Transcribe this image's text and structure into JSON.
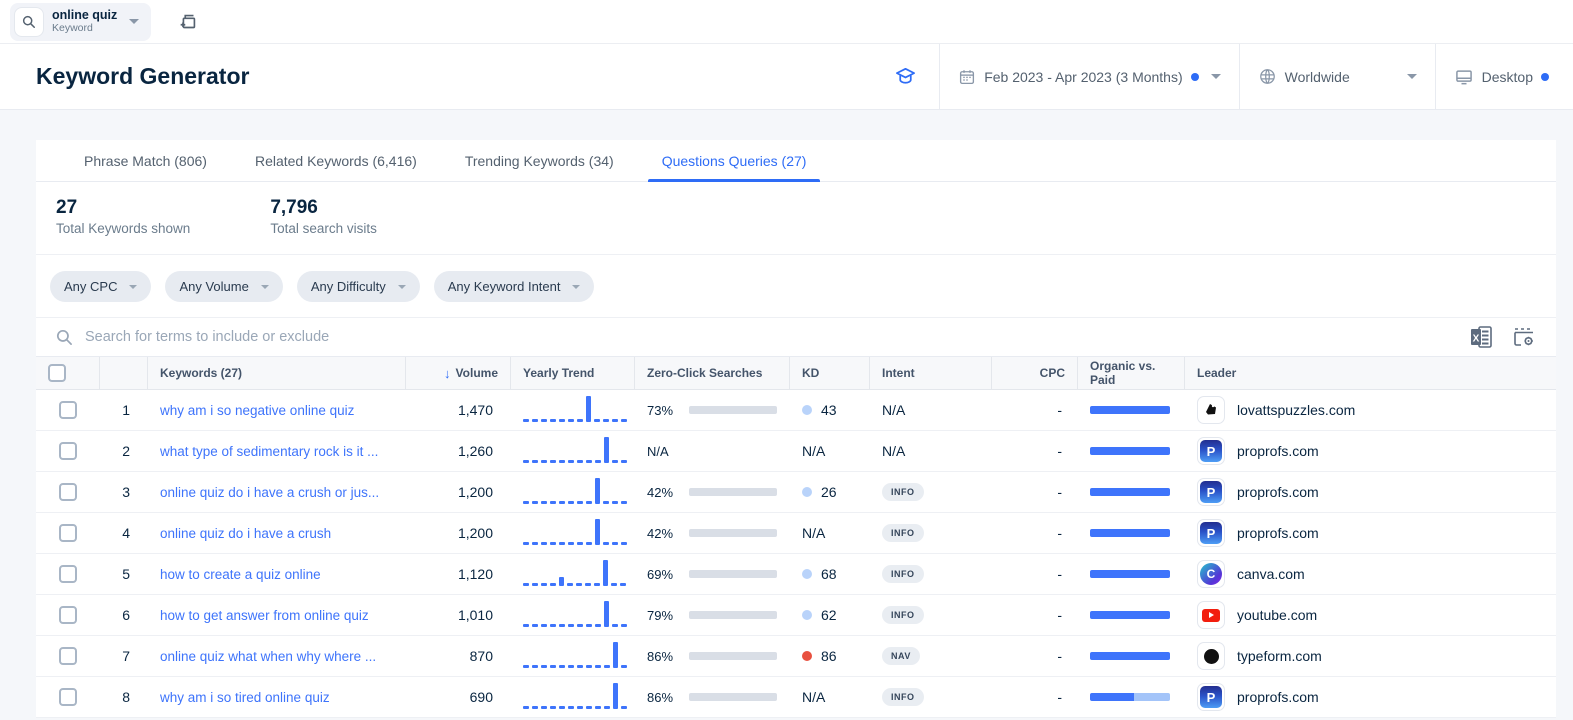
{
  "topbar": {
    "keyword_value": "online quiz",
    "keyword_type_label": "Keyword"
  },
  "header": {
    "title": "Keyword Generator",
    "date_range": "Feb 2023 - Apr 2023 (3 Months)",
    "region": "Worldwide",
    "device": "Desktop"
  },
  "tabs": [
    {
      "label": "Phrase Match (806)",
      "active": false
    },
    {
      "label": "Related Keywords (6,416)",
      "active": false
    },
    {
      "label": "Trending Keywords (34)",
      "active": false
    },
    {
      "label": "Questions Queries (27)",
      "active": true
    }
  ],
  "stats": [
    {
      "value": "27",
      "label": "Total Keywords shown"
    },
    {
      "value": "7,796",
      "label": "Total search visits"
    }
  ],
  "filters": [
    "Any CPC",
    "Any Volume",
    "Any Difficulty",
    "Any Keyword Intent"
  ],
  "search": {
    "placeholder": "Search for terms to include or exclude"
  },
  "colors": {
    "accent": "#2e6cf6",
    "bar_blue": "#3e74fb",
    "kd_dot_low": "#b9d3fa",
    "kd_dot_high": "#e8503f",
    "paid_bar": "#a3c4f9"
  },
  "table": {
    "columns": [
      {
        "label": ""
      },
      {
        "label": ""
      },
      {
        "label": "Keywords (27)"
      },
      {
        "label": "Volume",
        "sorted": true
      },
      {
        "label": "Yearly Trend"
      },
      {
        "label": "Zero-Click Searches"
      },
      {
        "label": "KD"
      },
      {
        "label": "Intent"
      },
      {
        "label": "CPC"
      },
      {
        "label": "Organic vs. Paid"
      },
      {
        "label": "Leader"
      }
    ],
    "rows": [
      {
        "rank": "1",
        "keyword": "why am i so negative online quiz",
        "volume": "1,470",
        "trend": [
          0,
          0,
          0,
          0,
          0,
          0,
          0,
          1,
          0,
          0,
          0,
          0
        ],
        "zero_click": "73%",
        "zero_click_pct": 73,
        "kd": "43",
        "kd_dot": "low",
        "intent": "N/A",
        "intent_type": "text",
        "cpc": "-",
        "organic_pct": 100,
        "leader": "lovattspuzzles.com",
        "favicon": "puzzle"
      },
      {
        "rank": "2",
        "keyword": "what type of sedimentary rock is it ...",
        "volume": "1,260",
        "trend": [
          0,
          0,
          0,
          0,
          0,
          0,
          0,
          0,
          0,
          1,
          0,
          0
        ],
        "zero_click": "N/A",
        "zero_click_pct": null,
        "kd": "N/A",
        "kd_dot": null,
        "intent": "N/A",
        "intent_type": "text",
        "cpc": "-",
        "organic_pct": 100,
        "leader": "proprofs.com",
        "favicon": "proprofs"
      },
      {
        "rank": "3",
        "keyword": "online quiz do i have a crush or jus...",
        "volume": "1,200",
        "trend": [
          0,
          0,
          0,
          0,
          0,
          0,
          0,
          0,
          1,
          0,
          0,
          0
        ],
        "zero_click": "42%",
        "zero_click_pct": 42,
        "kd": "26",
        "kd_dot": "low",
        "intent": "INFO",
        "intent_type": "badge",
        "cpc": "-",
        "organic_pct": 100,
        "leader": "proprofs.com",
        "favicon": "proprofs"
      },
      {
        "rank": "4",
        "keyword": "online quiz do i have a crush",
        "volume": "1,200",
        "trend": [
          0,
          0,
          0,
          0,
          0,
          0,
          0,
          0,
          1,
          0,
          0,
          0
        ],
        "zero_click": "42%",
        "zero_click_pct": 42,
        "kd": "N/A",
        "kd_dot": null,
        "intent": "INFO",
        "intent_type": "badge",
        "cpc": "-",
        "organic_pct": 100,
        "leader": "proprofs.com",
        "favicon": "proprofs"
      },
      {
        "rank": "5",
        "keyword": "how to create a quiz online",
        "volume": "1,120",
        "trend": [
          0,
          0,
          0,
          0,
          0.35,
          0,
          0,
          0,
          0,
          1,
          0,
          0
        ],
        "zero_click": "69%",
        "zero_click_pct": 69,
        "kd": "68",
        "kd_dot": "low",
        "intent": "INFO",
        "intent_type": "badge",
        "cpc": "-",
        "organic_pct": 100,
        "leader": "canva.com",
        "favicon": "canva"
      },
      {
        "rank": "6",
        "keyword": "how to get answer from online quiz",
        "volume": "1,010",
        "trend": [
          0,
          0,
          0,
          0,
          0,
          0,
          0,
          0,
          0,
          1,
          0,
          0
        ],
        "zero_click": "79%",
        "zero_click_pct": 79,
        "kd": "62",
        "kd_dot": "low",
        "intent": "INFO",
        "intent_type": "badge",
        "cpc": "-",
        "organic_pct": 100,
        "leader": "youtube.com",
        "favicon": "youtube"
      },
      {
        "rank": "7",
        "keyword": "online quiz what when why where ...",
        "volume": "870",
        "trend": [
          0,
          0,
          0,
          0,
          0,
          0,
          0,
          0,
          0,
          0,
          1,
          0
        ],
        "zero_click": "86%",
        "zero_click_pct": 86,
        "kd": "86",
        "kd_dot": "high",
        "intent": "NAV",
        "intent_type": "badge",
        "cpc": "-",
        "organic_pct": 100,
        "leader": "typeform.com",
        "favicon": "typeform"
      },
      {
        "rank": "8",
        "keyword": "why am i so tired online quiz",
        "volume": "690",
        "trend": [
          0,
          0,
          0,
          0,
          0,
          0,
          0,
          0,
          0,
          0,
          1,
          0
        ],
        "zero_click": "86%",
        "zero_click_pct": 86,
        "kd": "N/A",
        "kd_dot": null,
        "intent": "INFO",
        "intent_type": "badge",
        "cpc": "-",
        "organic_pct": 55,
        "leader": "proprofs.com",
        "favicon": "proprofs"
      }
    ]
  }
}
